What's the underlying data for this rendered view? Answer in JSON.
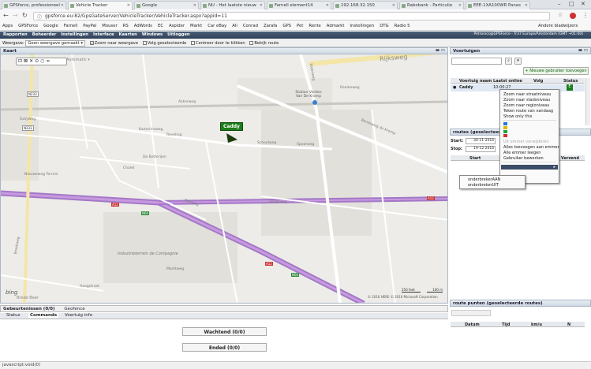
{
  "browser": {
    "tabs": [
      {
        "title": "GPSforce, professioneel"
      },
      {
        "title": "Vehicle Tracker",
        "active": true
      },
      {
        "title": "Google"
      },
      {
        "title": "NU - Het laatste nieuw"
      },
      {
        "title": "Farnell element14"
      },
      {
        "title": "192.168.32.150"
      },
      {
        "title": "Rabobank - Particulie"
      },
      {
        "title": "EEE-1XA100WR Panas"
      }
    ],
    "url": "gpsforce.eu:82/GpsGateServer/VehicleTracker/VehicleTracker.aspx?appid=11",
    "bookmarks": [
      "Apps",
      "GPSForce",
      "Google",
      "Farnell",
      "PayPal",
      "Mouser",
      "RS",
      "AdWords",
      "EC",
      "Aspider",
      "Markt",
      "Car eBay",
      "Ali",
      "Conrad",
      "Zarafa",
      "GPS",
      "Pet",
      "Rente",
      "Admarkt",
      "Instellingen",
      "DTG",
      "Radio 5"
    ],
    "other_bookmarks": "Andere bladwijzers"
  },
  "app": {
    "menu": [
      "Rapporten",
      "Beheerder",
      "Instellingen",
      "Interface",
      "Kaarten",
      "Windows",
      "Uitloggen"
    ],
    "user_info": "Petronics@GPSForce - Tr37 Europe/Amsterdam (GMT +01:00)",
    "map_tools": {
      "weergave_label": "Weergave:",
      "weergave_value": "Geen weergave gemaakt",
      "zoom_label": "Zoom naar weergave",
      "volg_label": "Volg geselecteerde",
      "centreer_label": "Centreer door te klikken",
      "bekijk_label": "Bekijk route"
    }
  },
  "map": {
    "panel_title": "Kaart",
    "mode_label": "Automatic",
    "vehicle_label": "Caddy",
    "places": [
      "Rijksweg",
      "Steenweg",
      "Station Vorden Van De Kromp",
      "Bondsweg de Kromp",
      "Roelenweg",
      "Schoolweg",
      "Kamerinsweg",
      "Reveling",
      "Akkerweg",
      "Spoorweg",
      "Chalet",
      "De Botterijen",
      "Tienweg",
      "Smithweg",
      "Industrieterrein de Compagnie",
      "Broekweg",
      "Gutyweg",
      "Hoogstraat",
      "Marktweg",
      "Nieuweweg Terrein"
    ],
    "roads": [
      "N233",
      "N233",
      "A12",
      "A12",
      "N66",
      "N66",
      "A12"
    ],
    "scale_feet": "250 feet",
    "scale_m": "100 m",
    "copyright": "© 2016 HERE   © 2016 Microsoft Corporation",
    "logo": "bing",
    "city": "Brede Beer"
  },
  "vehicles_panel": {
    "title": "Voertuigen",
    "add_button": "Nieuwe gebruiker toevoegen",
    "columns": [
      "Voertuig naam",
      "Laatst online",
      "Volg",
      "Status"
    ],
    "rows": [
      {
        "name": "Caddy",
        "last_online": "10:00:27"
      }
    ]
  },
  "routes_panel": {
    "title": "routes (geselecteerd)",
    "start_label": "Start:",
    "start_date": "30-11-2016",
    "stop_label": "Stop:",
    "stop_date": "19-12-2016",
    "columns": [
      "Start",
      "Verzend"
    ]
  },
  "context_menu": {
    "items": [
      "Zoom naar straatniveau",
      "Zoom naar stadsniveau",
      "Zoom naar regioniveau",
      "Teken route van vandaag",
      "Show only this",
      "",
      "Uit emmer verwijderen",
      "Alles toevoegen aan emmer",
      "Alle emmer leegen",
      "Gebruiker bewerken",
      ""
    ],
    "colors": [
      "#1f77d4",
      "#e0b700",
      "#21a33f",
      "#d93025"
    ],
    "submenu": [
      "onderbrekerAAN",
      "onderbrekerUIT"
    ]
  },
  "route_points_panel": {
    "title": "route punten (geselecteerde routes)",
    "columns": [
      "Datum",
      "Tijd",
      "km/u",
      "N"
    ]
  },
  "bottom_panel": {
    "tabs_top": [
      "Gebeurtenissen (0/0)",
      "Geofence"
    ],
    "tabs": [
      "Status",
      "Commands",
      "Voertuig info"
    ],
    "btn_wachtend": "Wachtend (0/0)",
    "btn_ended": "Ended (0/0)"
  },
  "statusbar": "javascript:void(0)"
}
